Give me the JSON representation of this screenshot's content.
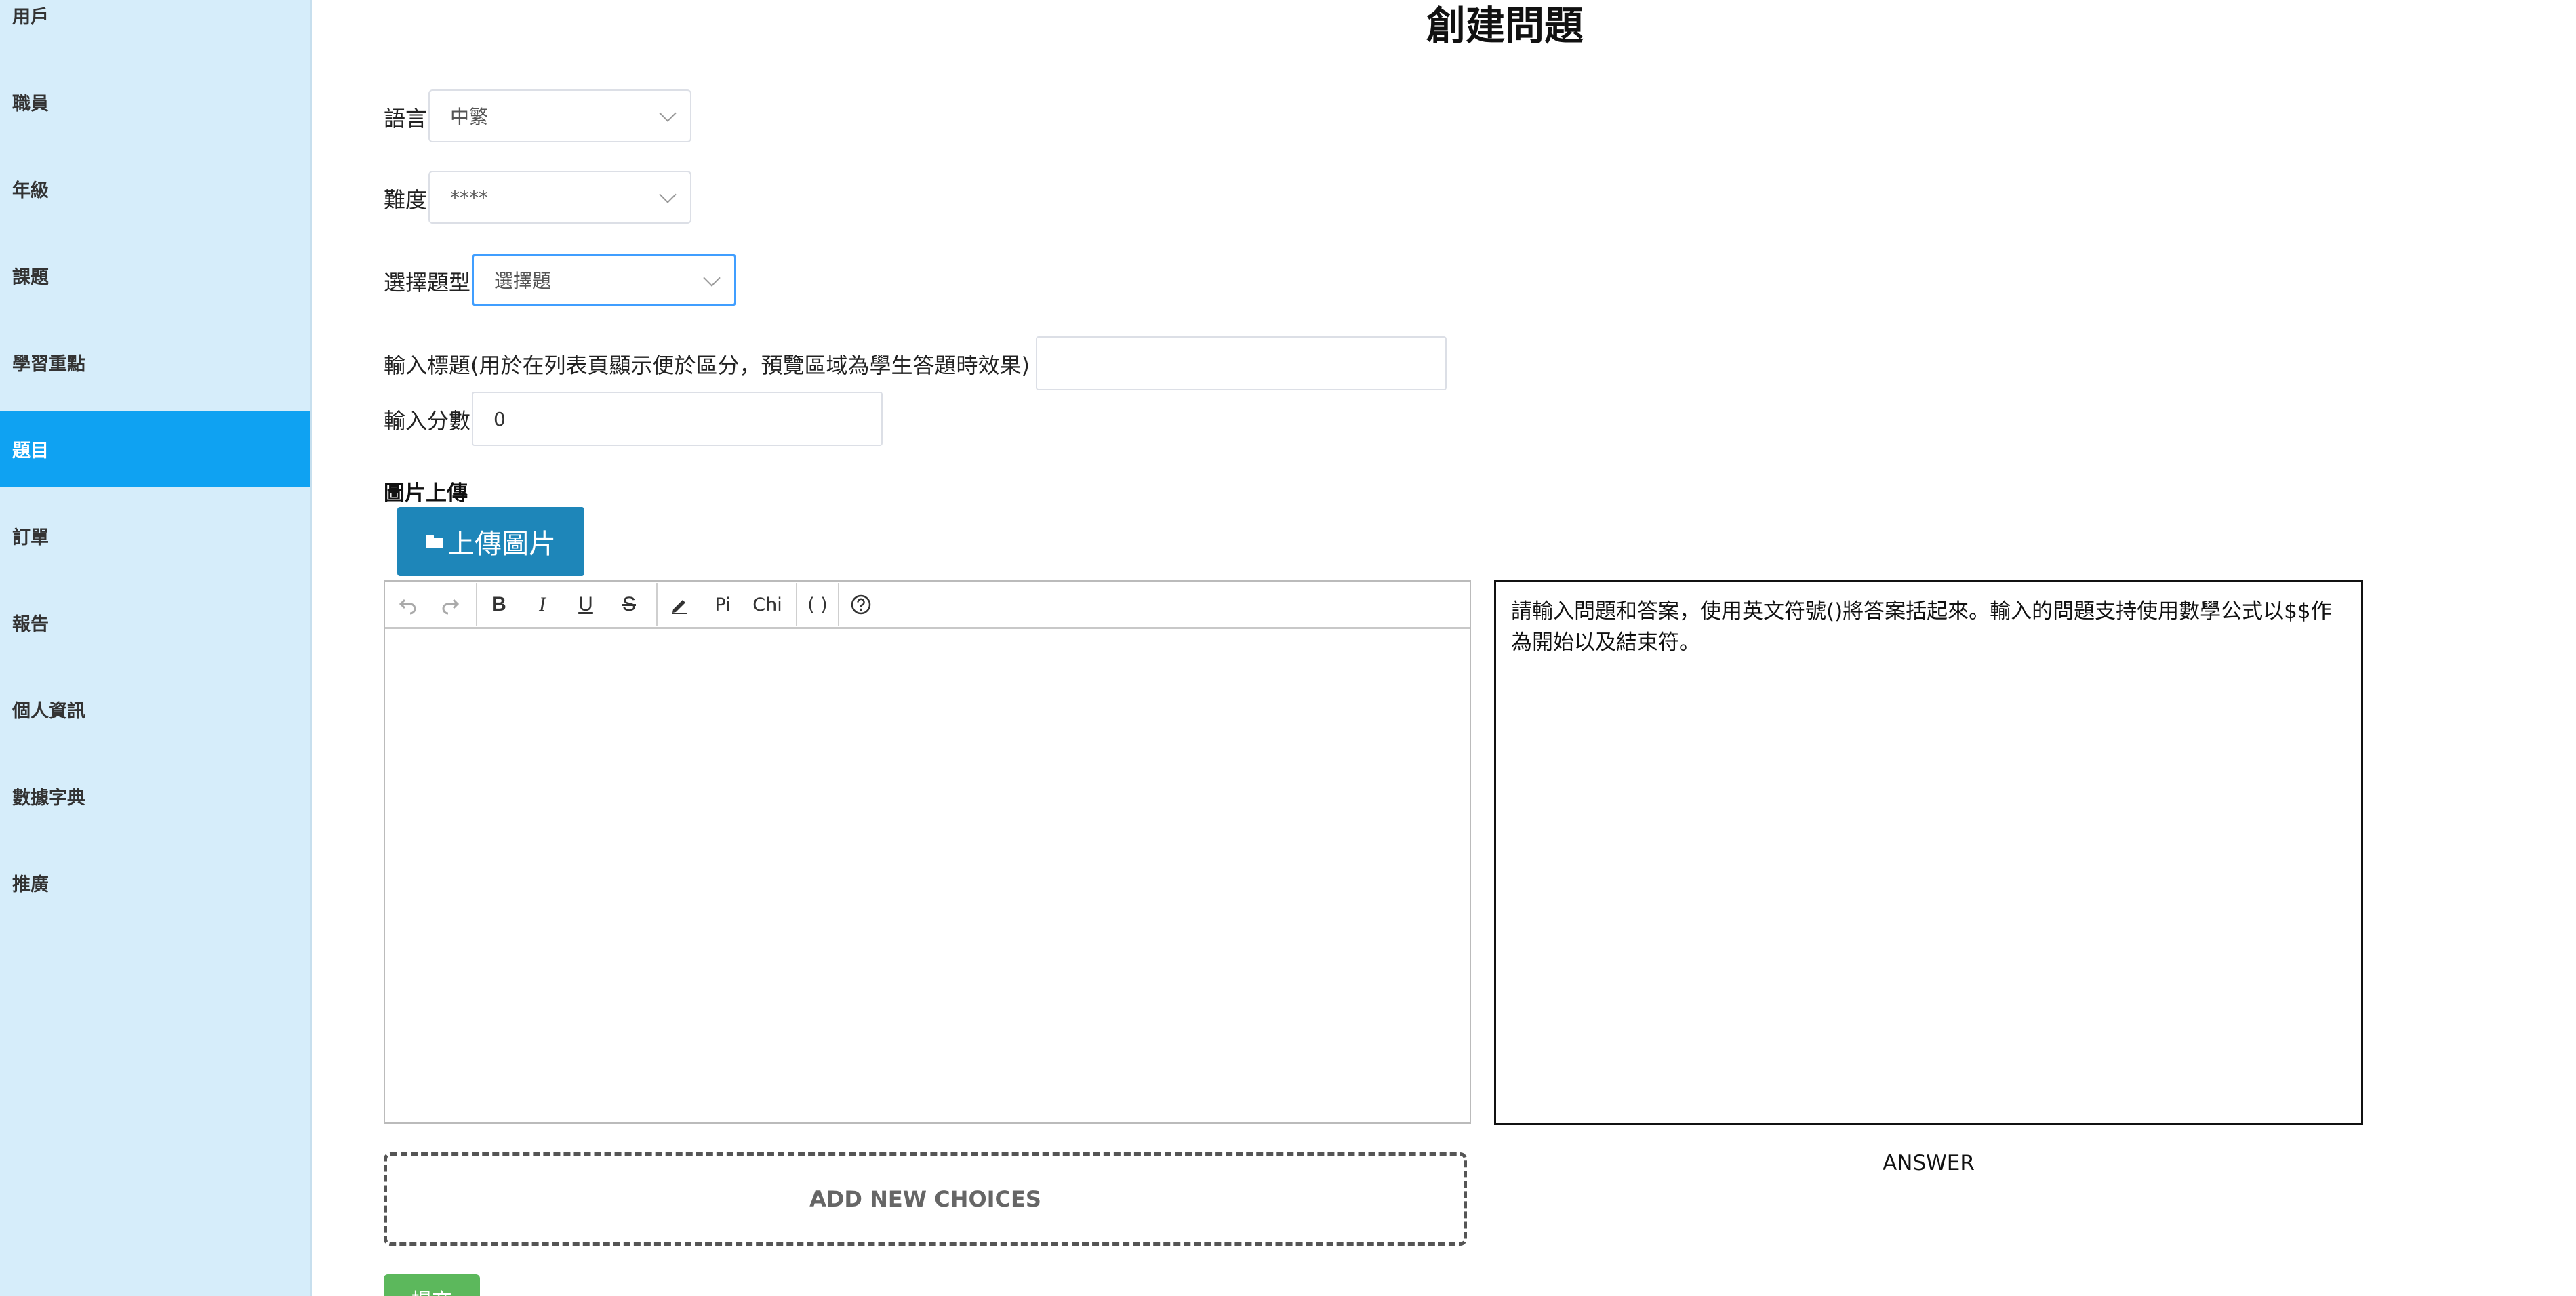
{
  "sidebar": {
    "items": [
      {
        "label": "用戶"
      },
      {
        "label": "職員"
      },
      {
        "label": "年級"
      },
      {
        "label": "課題"
      },
      {
        "label": "學習重點"
      },
      {
        "label": "題目"
      },
      {
        "label": "訂單"
      },
      {
        "label": "報告"
      },
      {
        "label": "個人資訊"
      },
      {
        "label": "數據字典"
      },
      {
        "label": "推廣"
      }
    ],
    "active_item": "題目",
    "active_color": "#0fa2f2",
    "background_color": "#d6edfa"
  },
  "page": {
    "title": "創建問題"
  },
  "form": {
    "language": {
      "label": "語言",
      "value": "中繁"
    },
    "difficulty": {
      "label": "難度",
      "value": "****"
    },
    "question_type": {
      "label": "選擇題型",
      "value": "選擇題"
    },
    "title_input": {
      "label": "輸入標題(用於在列表頁顯示便於區分，預覽區域為學生答題時效果)",
      "value": ""
    },
    "score_input": {
      "label": "輸入分數",
      "value": "0"
    },
    "image_upload": {
      "label": "圖片上傳",
      "button_label": "上傳圖片",
      "button_color": "#1e86b9"
    }
  },
  "editor": {
    "toolbar": {
      "undo_icon": "undo-icon",
      "redo_icon": "redo-icon",
      "bold_label": "B",
      "italic_label": "I",
      "underline_label": "U",
      "strike_label": "S",
      "highlight_icon": "pencil-icon",
      "pi_label": "Pi",
      "chi_label": "Chi",
      "paren_label": "( )",
      "help_icon": "help-icon"
    },
    "content": ""
  },
  "answer": {
    "instructions": "請輸入問題和答案，使用英文符號()將答案括起來。輸入的問題支持使用數學公式以$$作為開始以及結束符。",
    "label": "ANSWER"
  },
  "actions": {
    "add_choices_label": "ADD NEW CHOICES",
    "submit_label": "提交",
    "submit_color": "#5cb85c"
  }
}
